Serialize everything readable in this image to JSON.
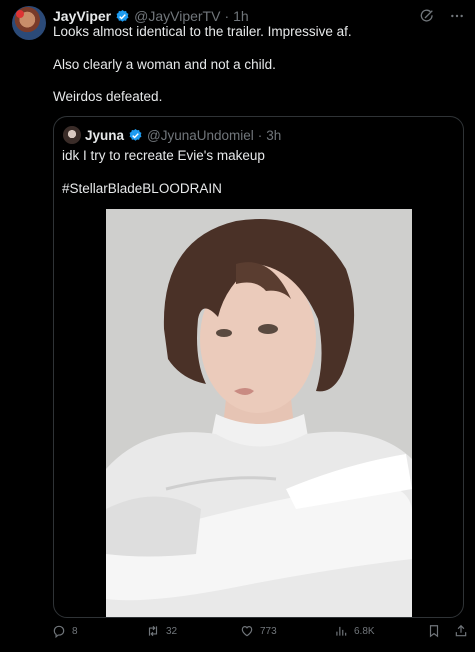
{
  "author": {
    "name": "JayViper",
    "handle": "@JayViperTV",
    "separator": "·",
    "time": "1h"
  },
  "tweet": {
    "lines": [
      "Looks almost identical to the trailer. Impressive af.",
      "Also clearly a woman and not a child.",
      "Weirdos defeated."
    ]
  },
  "quoted": {
    "name": "Jyuna",
    "handle": "@JyunaUndomiel",
    "separator": "·",
    "time": "3h",
    "lines": [
      "idk I try to recreate Evie's makeup",
      "#StellarBladeBLOODRAIN"
    ]
  },
  "actions": {
    "replies": "8",
    "reposts": "32",
    "likes": "773",
    "views": "6.8K"
  },
  "colors": {
    "background": "#000000",
    "text": "#e7e9ea",
    "muted": "#71767b",
    "verified": "#1d9bf0",
    "border": "#2f3336"
  },
  "icons": [
    "verified-badge-icon",
    "grok-icon",
    "more-icon",
    "reply-icon",
    "repost-icon",
    "like-icon",
    "views-icon",
    "bookmark-icon",
    "share-icon"
  ]
}
